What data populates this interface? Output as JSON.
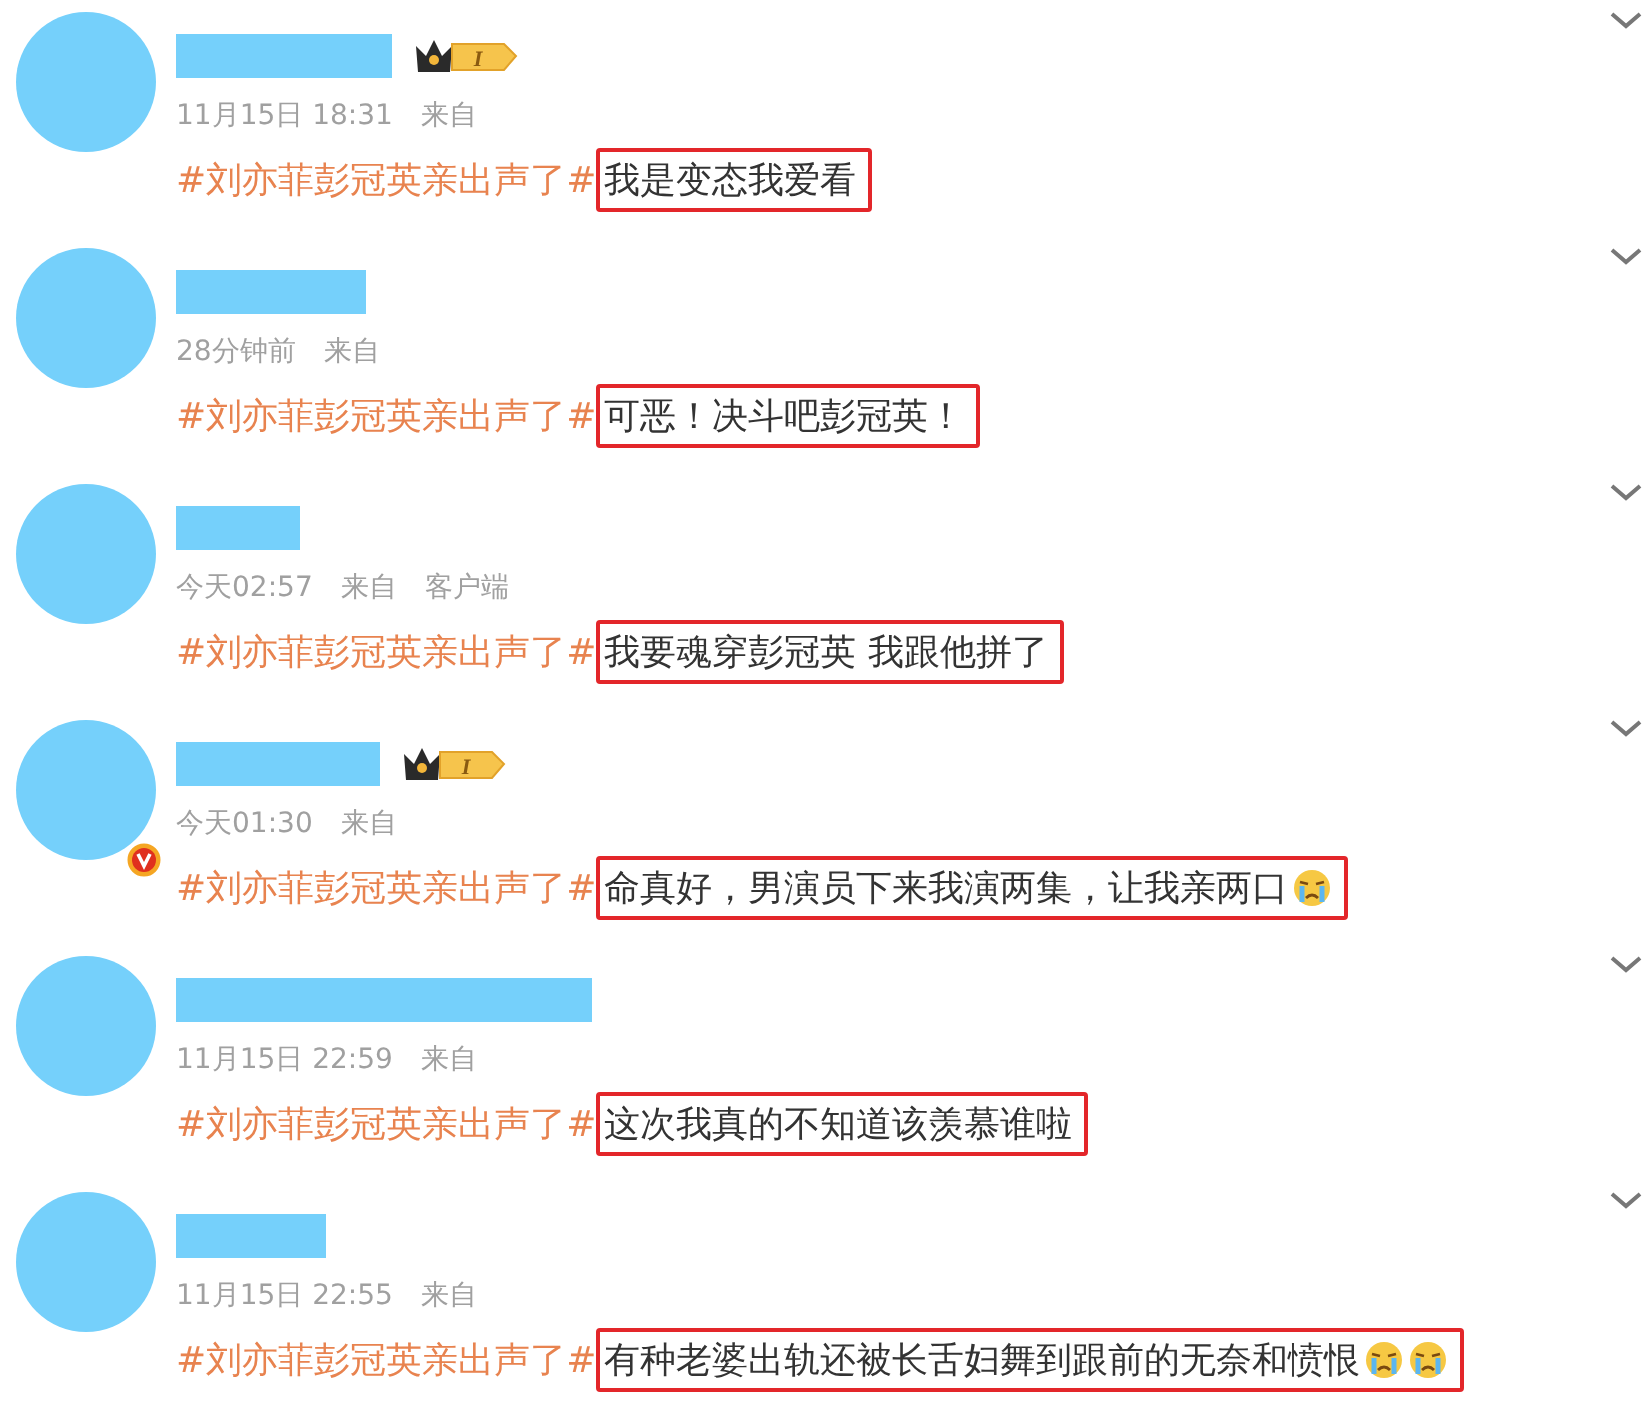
{
  "comments": [
    {
      "member_badge": true,
      "badge_level": "I",
      "verified": false,
      "time": "11月15日 18:31",
      "source_label": "来自",
      "hashtag": "#刘亦菲彭冠英亲出声了#",
      "text": "我是变态我爱看",
      "highlighted": true
    },
    {
      "member_badge": false,
      "verified": false,
      "time": "28分钟前",
      "source_label": "来自",
      "hashtag": "#刘亦菲彭冠英亲出声了#",
      "text": "可恶！决斗吧彭冠英！",
      "highlighted": true
    },
    {
      "member_badge": false,
      "verified": false,
      "time": "今天02:57",
      "source_label": "来自",
      "client": "客户端",
      "hashtag": "#刘亦菲彭冠英亲出声了#",
      "text": "我要魂穿彭冠英 我跟他拼了",
      "highlighted": true
    },
    {
      "member_badge": true,
      "badge_level": "I",
      "verified": true,
      "time": "今天01:30",
      "source_label": "来自",
      "hashtag": "#刘亦菲彭冠英亲出声了#",
      "text": "命真好，男演员下来我演两集，让我亲两口",
      "highlighted": true,
      "emojis": [
        {
          "kind": "crying"
        }
      ]
    },
    {
      "member_badge": false,
      "verified": false,
      "time": "11月15日 22:59",
      "source_label": "来自",
      "hashtag": "#刘亦菲彭冠英亲出声了#",
      "text": "这次我真的不知道该羡慕谁啦",
      "highlighted": true
    },
    {
      "member_badge": false,
      "verified": false,
      "time": "11月15日 22:55",
      "source_label": "来自",
      "hashtag": "#刘亦菲彭冠英亲出声了#",
      "text": "有种老婆出轨还被长舌妇舞到跟前的无奈和愤恨",
      "highlighted": true,
      "emojis": [
        {
          "kind": "crying"
        },
        {
          "kind": "crying"
        }
      ]
    }
  ]
}
